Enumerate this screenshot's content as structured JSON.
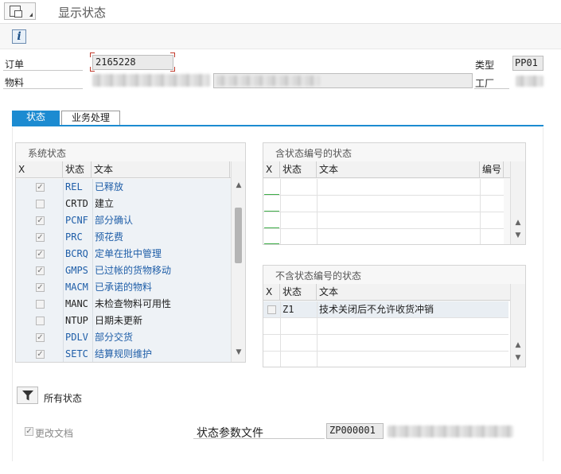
{
  "title_bar": {
    "title": "显示状态",
    "menu_icon": "layout-menu-icon"
  },
  "toolbar": {
    "info_icon": "info-icon",
    "info_glyph": "i"
  },
  "header": {
    "order_label": "订单",
    "order_value": "2165228",
    "type_label": "类型",
    "type_value": "PP01",
    "material_label": "物料",
    "plant_label": "工厂"
  },
  "tabs": [
    {
      "label": "状态",
      "active": true
    },
    {
      "label": "业务处理",
      "active": false
    }
  ],
  "system_status": {
    "title": "系统状态",
    "columns": [
      "X",
      "状态",
      "文本"
    ],
    "rows": [
      {
        "checked": true,
        "code": "REL",
        "text": "已释放",
        "active": true
      },
      {
        "checked": false,
        "code": "CRTD",
        "text": "建立",
        "active": false
      },
      {
        "checked": true,
        "code": "PCNF",
        "text": "部分确认",
        "active": true
      },
      {
        "checked": true,
        "code": "PRC",
        "text": "预花费",
        "active": true
      },
      {
        "checked": true,
        "code": "BCRQ",
        "text": "定单在批中管理",
        "active": true
      },
      {
        "checked": true,
        "code": "GMPS",
        "text": "已过帐的货物移动",
        "active": true
      },
      {
        "checked": true,
        "code": "MACM",
        "text": "已承诺的物料",
        "active": true
      },
      {
        "checked": false,
        "code": "MANC",
        "text": "未检查物料可用性",
        "active": false
      },
      {
        "checked": false,
        "code": "NTUP",
        "text": "日期未更新",
        "active": false
      },
      {
        "checked": true,
        "code": "PDLV",
        "text": "部分交货",
        "active": true
      },
      {
        "checked": true,
        "code": "SETC",
        "text": "结算规则维护",
        "active": true
      }
    ]
  },
  "user_status_numbered": {
    "title": "含状态编号的状态",
    "columns": [
      "X",
      "状态",
      "文本",
      "编号"
    ]
  },
  "user_status_unnumbered": {
    "title": "不含状态编号的状态",
    "columns": [
      "X",
      "状态",
      "文本"
    ],
    "rows": [
      {
        "checked": false,
        "code": "Z1",
        "text": "技术关闭后不允许收货冲销"
      }
    ]
  },
  "bottom": {
    "all_status_label": "所有状态",
    "filter_icon": "filter-icon",
    "change_docs_label": "更改文档",
    "change_docs_checked": true,
    "status_profile_label": "状态参数文件",
    "status_profile_value": "ZP000001"
  },
  "colors": {
    "accent": "#1c8bd1",
    "active_text": "#1f5ea8"
  }
}
